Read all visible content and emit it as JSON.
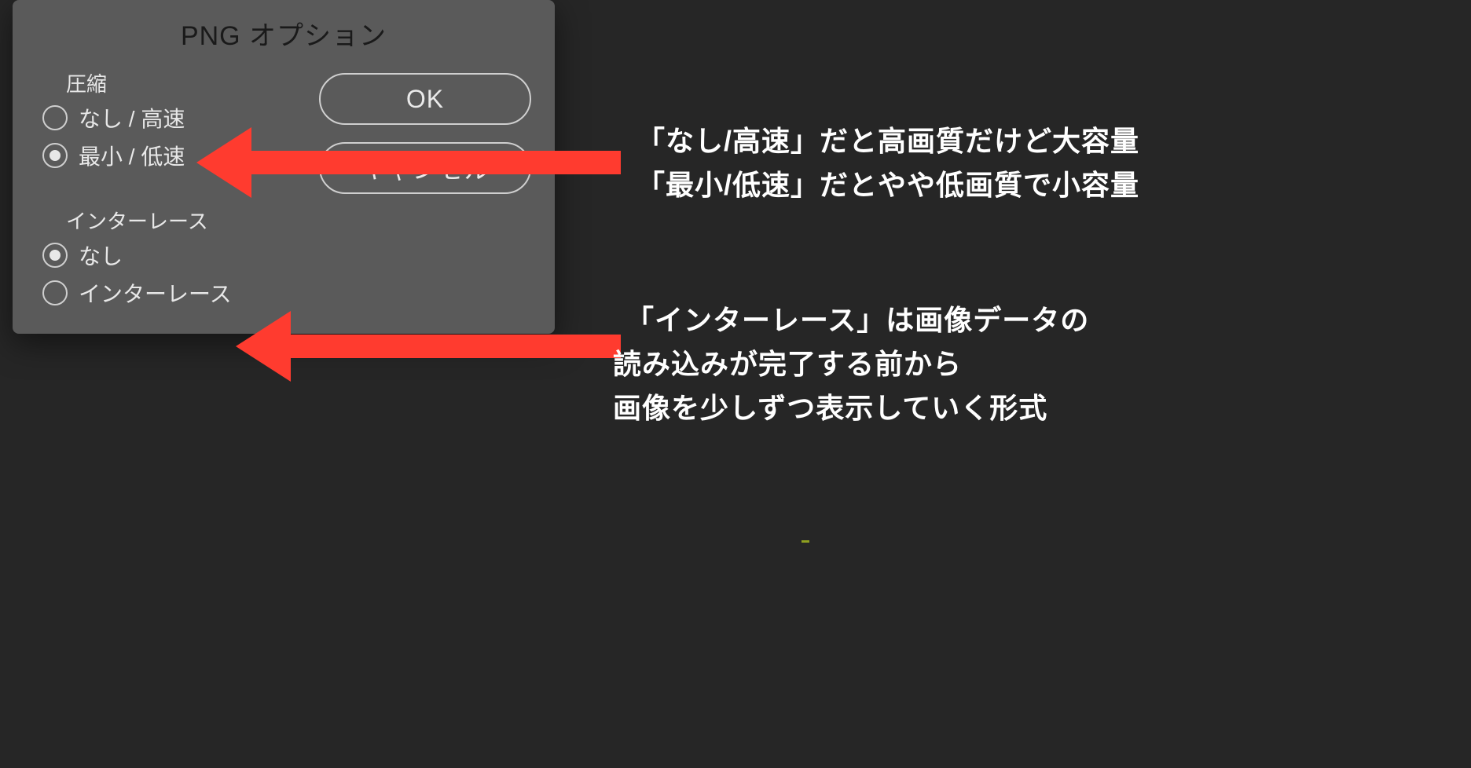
{
  "dialog": {
    "title": "PNG オプション",
    "compression": {
      "label": "圧縮",
      "options": [
        {
          "key": "none_fast",
          "label": "なし / 高速",
          "selected": false
        },
        {
          "key": "min_slow",
          "label": "最小 / 低速",
          "selected": true
        }
      ]
    },
    "interlace": {
      "label": "インターレース",
      "options": [
        {
          "key": "none",
          "label": "なし",
          "selected": true
        },
        {
          "key": "interlace",
          "label": "インターレース",
          "selected": false
        }
      ]
    },
    "buttons": {
      "ok": "OK",
      "cancel": "キャンセル"
    }
  },
  "notes": {
    "compression_a": "「なし/高速」だと高画質だけど大容量",
    "compression_b": "「最小/低速」だとやや低画質で小容量",
    "interlace_a": "「インターレース」は画像データの",
    "interlace_b": "読み込みが完了する前から",
    "interlace_c": "画像を少しずつ表示していく形式"
  },
  "colors": {
    "arrow": "#ff3b2f"
  }
}
